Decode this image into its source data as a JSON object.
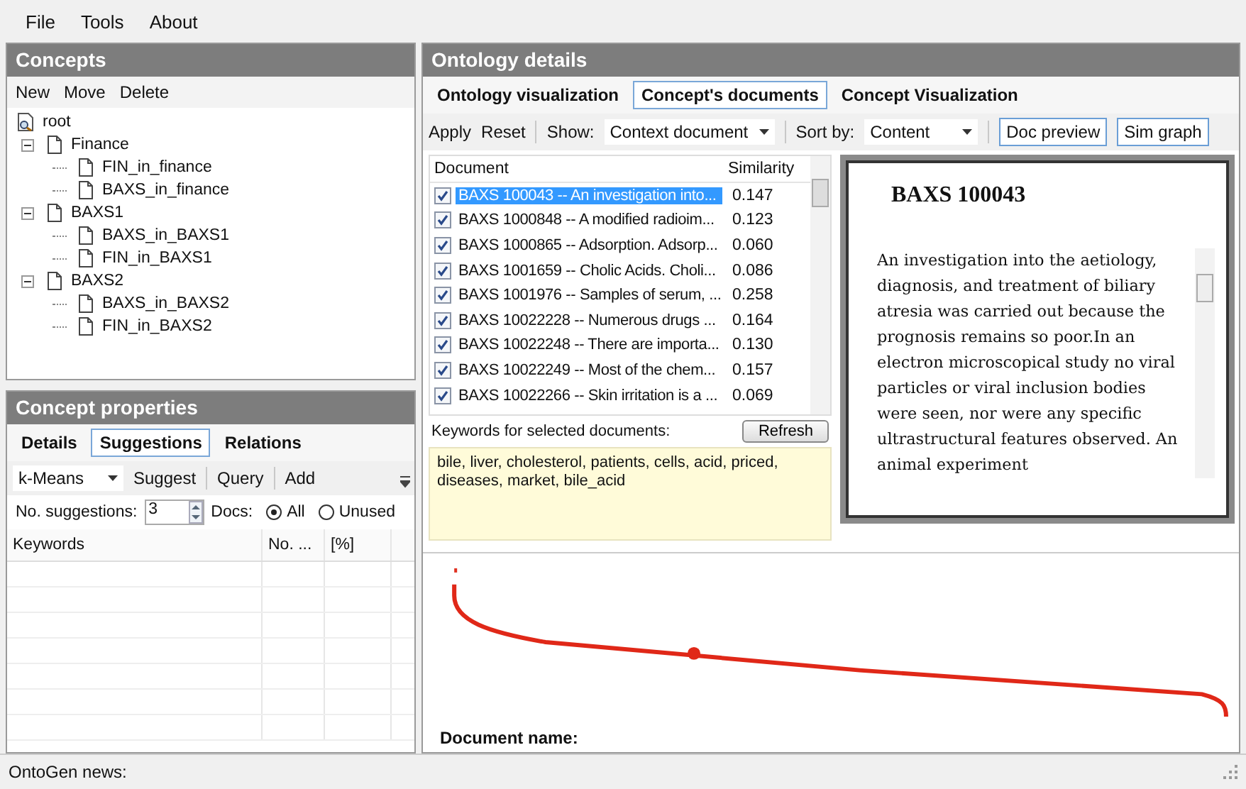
{
  "menu": [
    "File",
    "Tools",
    "About"
  ],
  "concepts": {
    "title": "Concepts",
    "actions": [
      "New",
      "Move",
      "Delete"
    ],
    "tree": {
      "label": "root",
      "children": [
        {
          "label": "Finance",
          "expanded": true,
          "children": [
            {
              "label": "FIN_in_finance"
            },
            {
              "label": "BAXS_in_finance"
            }
          ]
        },
        {
          "label": "BAXS1",
          "expanded": true,
          "children": [
            {
              "label": "BAXS_in_BAXS1"
            },
            {
              "label": "FIN_in_BAXS1"
            }
          ]
        },
        {
          "label": "BAXS2",
          "expanded": true,
          "children": [
            {
              "label": "BAXS_in_BAXS2"
            },
            {
              "label": "FIN_in_BAXS2"
            }
          ]
        }
      ]
    }
  },
  "properties": {
    "title": "Concept properties",
    "tabs": [
      {
        "label": "Details",
        "selected": false
      },
      {
        "label": "Suggestions",
        "selected": true
      },
      {
        "label": "Relations",
        "selected": false
      }
    ],
    "method": "k-Means",
    "actions": [
      "Suggest",
      "Query",
      "Add"
    ],
    "suggestions_label": "No. suggestions:",
    "suggestions_value": "3",
    "docs_label": "Docs:",
    "docs_options": [
      {
        "label": "All",
        "selected": true
      },
      {
        "label": "Unused",
        "selected": false
      }
    ],
    "columns": [
      "Keywords",
      "No. ...",
      "[%]"
    ]
  },
  "details": {
    "title": "Ontology details",
    "tabs": [
      {
        "label": "Ontology visualization",
        "selected": false
      },
      {
        "label": "Concept's documents",
        "selected": true
      },
      {
        "label": "Concept Visualization",
        "selected": false
      }
    ],
    "actions": [
      "Apply",
      "Reset"
    ],
    "show_label": "Show:",
    "show_value": "Context document",
    "sort_label": "Sort by:",
    "sort_value": "Content",
    "toggles": [
      {
        "label": "Doc preview",
        "on": true
      },
      {
        "label": "Sim graph",
        "on": true
      }
    ],
    "columns": [
      "Document",
      "Similarity"
    ],
    "documents": [
      {
        "title": "BAXS 100043 -- An investigation into...",
        "similarity": "0.147",
        "checked": true,
        "selected": true
      },
      {
        "title": "BAXS 1000848 -- A modified radioim...",
        "similarity": "0.123",
        "checked": true,
        "selected": false
      },
      {
        "title": "BAXS 1000865 -- Adsorption. Adsorp...",
        "similarity": "0.060",
        "checked": true,
        "selected": false
      },
      {
        "title": "BAXS 1001659 -- Cholic Acids. Choli...",
        "similarity": "0.086",
        "checked": true,
        "selected": false
      },
      {
        "title": "BAXS 1001976 -- Samples of serum, ...",
        "similarity": "0.258",
        "checked": true,
        "selected": false
      },
      {
        "title": "BAXS 10022228 -- Numerous drugs ...",
        "similarity": "0.164",
        "checked": true,
        "selected": false
      },
      {
        "title": "BAXS 10022248 -- There are importa...",
        "similarity": "0.130",
        "checked": true,
        "selected": false
      },
      {
        "title": "BAXS 10022249 -- Most of the chem...",
        "similarity": "0.157",
        "checked": true,
        "selected": false
      },
      {
        "title": "BAXS 10022266 -- Skin irritation is a ...",
        "similarity": "0.069",
        "checked": true,
        "selected": false
      }
    ],
    "keywords_label": "Keywords for selected documents:",
    "refresh": "Refresh",
    "keywords": "bile, liver, cholesterol, patients, cells, acid, priced, diseases, market, bile_acid",
    "preview": {
      "title": "BAXS 100043",
      "body": "An investigation into the aetiology, diagnosis, and treatment of biliary atresia was carried out because the prognosis remains so poor.In an electron microscopical study no viral particles or viral inclusion bodies were seen, nor were any specific ultrastructural features observed. An animal experiment"
    },
    "document_name_label": "Document name:"
  },
  "status_bar": "OntoGen news:"
}
